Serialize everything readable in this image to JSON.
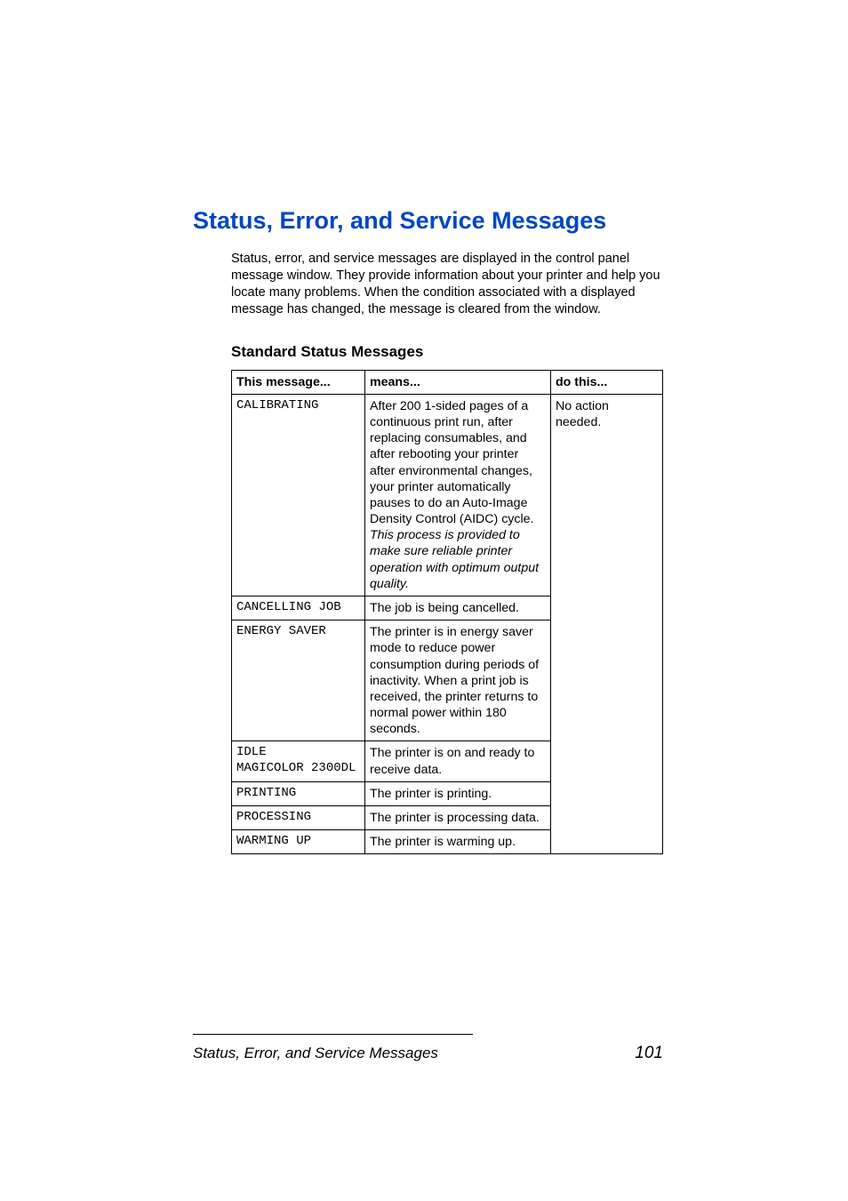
{
  "title": "Status, Error, and Service Messages",
  "intro": "Status, error, and service messages are displayed in the control panel message window. They provide information about your printer and help you locate many problems. When the condition associated with a displayed message has changed, the message is cleared from the window.",
  "sub_title": "Standard Status Messages",
  "headers": {
    "c1": "This message...",
    "c2": "means...",
    "c3": "do this..."
  },
  "rows": {
    "r1": {
      "msg": "CALIBRATING",
      "means_plain": "After 200 1-sided pages of a continuous print run, after replacing consumables, and after rebooting your printer after environmental changes, your printer automatically pauses to do an Auto-Image Density Control (AIDC) cycle. ",
      "means_italic": "This process is provided to make sure reliable printer operation with optimum output quality."
    },
    "r2": {
      "msg": "CANCELLING JOB",
      "means": "The job is being cancelled."
    },
    "r3": {
      "msg": "ENERGY SAVER",
      "means": "The printer is in energy saver mode to reduce power consumption during periods of inactivity. When a print job is received, the printer returns to normal power within 180 seconds."
    },
    "r4": {
      "msg_line1": "IDLE",
      "msg_line2": "MAGICOLOR 2300DL",
      "means": "The printer is on and ready to receive data."
    },
    "r5": {
      "msg": "PRINTING",
      "means": "The printer is printing."
    },
    "r6": {
      "msg": "PROCESSING",
      "means": "The printer is processing data."
    },
    "r7": {
      "msg": "WARMING UP",
      "means": "The printer is warming up."
    },
    "action": "No action needed."
  },
  "footer": {
    "left": "Status, Error, and Service Messages",
    "right": "101"
  }
}
